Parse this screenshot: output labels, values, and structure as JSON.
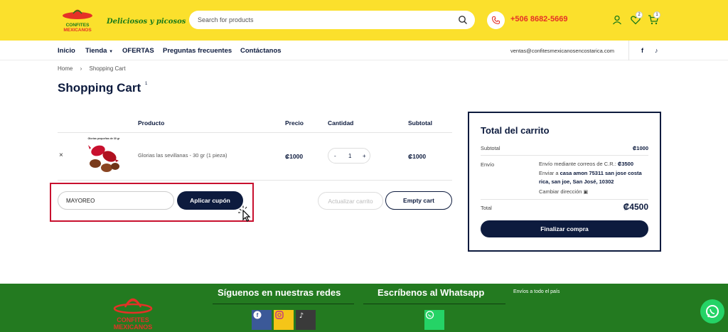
{
  "header": {
    "brand_logo_text": "CONFITES MEXICANOS",
    "tagline": "Deliciosos y picosos",
    "search_placeholder": "Search for products",
    "phone": "+506 8682-5669",
    "wishlist_count": "2",
    "cart_count": "1"
  },
  "nav": {
    "items": [
      "Inicio",
      "Tienda",
      "OFERTAS",
      "Preguntas frecuentes",
      "Contáctanos"
    ],
    "email": "ventas@confitesmexicanosencostarica.com"
  },
  "breadcrumb": [
    "Home",
    "Shopping Cart"
  ],
  "page": {
    "title": "Shopping Cart",
    "count": "1"
  },
  "cart": {
    "headers": [
      "Producto",
      "Precio",
      "Cantidad",
      "Subtotal"
    ],
    "item": {
      "image_caption": "Glorias pequeñas de 30 gr",
      "name": "Glorias las sevillanas - 30 gr (1 pieza)",
      "price": "₡1000",
      "qty": "1",
      "qty_minus": "-",
      "qty_plus": "+",
      "subtotal": "₡1000",
      "remove": "×"
    },
    "coupon_value": "MAYOREO",
    "apply_coupon": "Aplicar cupón",
    "update_cart": "Actualizar carrito",
    "empty_cart": "Empty cart"
  },
  "totals": {
    "title": "Total del carrito",
    "subtotal_label": "Subtotal",
    "subtotal_value": "₡1000",
    "shipping_label": "Envío",
    "shipping_method_prefix": "Envío mediante correos de C.R.:",
    "shipping_method_price": "₡3500",
    "ship_to_prefix": "Enviar a",
    "ship_to_address": "casa amon 75311 san jose costa rica, san joe, San José, 10302",
    "change_address": "Cambiar dirección",
    "total_label": "Total",
    "total_value": "₡4500",
    "checkout": "Finalizar compra"
  },
  "footer": {
    "social_heading": "Síguenos en nuestras redes",
    "whatsapp_heading": "Escríbenos al Whatsapp",
    "shipping_note": "Envíos a todo el país",
    "logo_text": "CONFITES MEXICANOS"
  },
  "colors": {
    "header_yellow": "#fbe02c",
    "navy": "#0d1b3e",
    "red_accent": "#e53127",
    "footer_green": "#237a20",
    "whatsapp_green": "#25d366"
  }
}
